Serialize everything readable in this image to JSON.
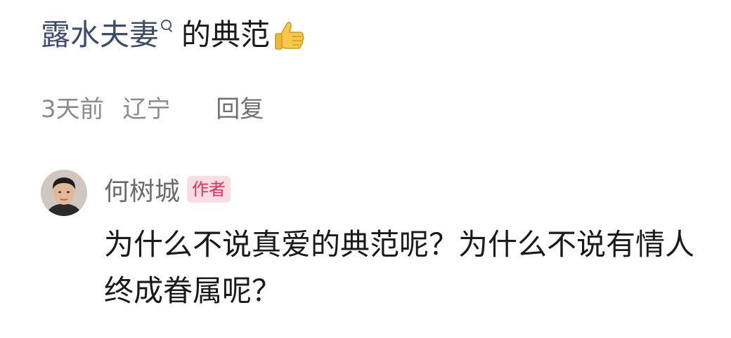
{
  "comment": {
    "keyword": "露水夫妻",
    "text_after": "的典范",
    "icons": {
      "search": "search-icon",
      "emoji": "thumbs-up-icon"
    },
    "time": "3天前",
    "location": "辽宁",
    "reply_label": "回复"
  },
  "reply": {
    "author": "何树城",
    "badge": "作者",
    "text": "为什么不说真爱的典范呢？为什么不说有情人终成眷属呢？",
    "colors": {
      "badge_bg": "#f9dde2",
      "badge_text": "#e0325a",
      "keyword": "#3d4c6e"
    }
  }
}
